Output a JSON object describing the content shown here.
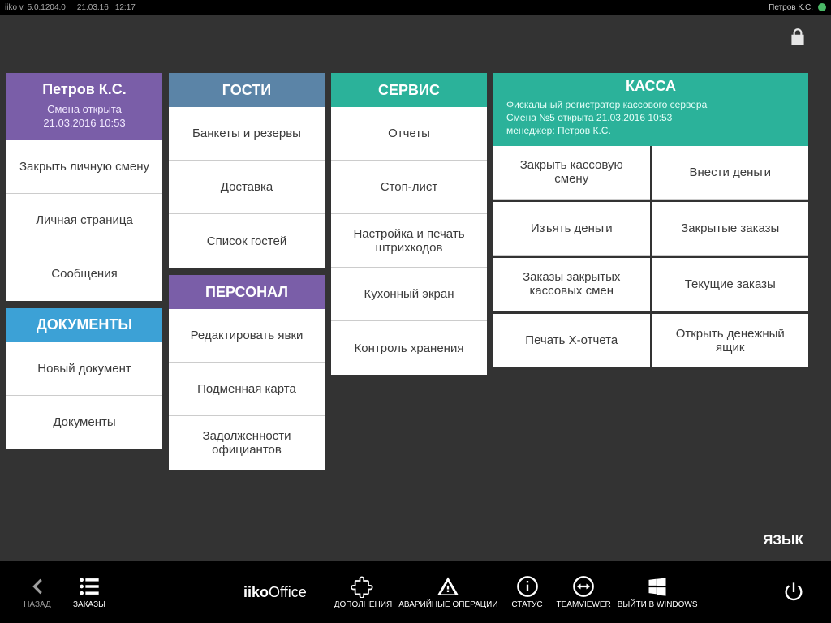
{
  "topbar": {
    "version": "iiko  v.  5.0.1204.0",
    "date": "21.03.16",
    "time": "12:17",
    "user": "Петров К.С."
  },
  "user_panel": {
    "name": "Петров К.С.",
    "shift_line1": "Смена открыта",
    "shift_line2": "21.03.2016 10:53",
    "items": [
      "Закрыть личную смену",
      "Личная страница",
      "Сообщения"
    ]
  },
  "documents": {
    "title": "ДОКУМЕНТЫ",
    "items": [
      "Новый документ",
      "Документы"
    ]
  },
  "guests": {
    "title": "ГОСТИ",
    "items": [
      "Банкеты и резервы",
      "Доставка",
      "Список гостей"
    ]
  },
  "personnel": {
    "title": "ПЕРСОНАЛ",
    "items": [
      "Редактировать явки",
      "Подменная карта",
      "Задолженности официантов"
    ]
  },
  "service": {
    "title": "СЕРВИС",
    "items": [
      "Отчеты",
      "Стоп-лист",
      "Настройка и печать штрихкодов",
      "Кухонный экран",
      "Контроль хранения"
    ]
  },
  "kassa": {
    "title": "КАССА",
    "sub1": "Фискальный регистратор кассового сервера",
    "sub2": "Смена №5 открыта 21.03.2016 10:53",
    "sub3": "менеджер: Петров К.С.",
    "items": [
      "Закрыть кассовую смену",
      "Внести деньги",
      "Изъять деньги",
      "Закрытые заказы",
      "Заказы закрытых кассовых смен",
      "Текущие заказы",
      "Печать X-отчета",
      "Открыть денежный ящик"
    ]
  },
  "language": "ЯЗЫК",
  "bottom": {
    "back": "НАЗАД",
    "orders": "ЗАКАЗЫ",
    "brand_bold": "iiko",
    "brand_light": "Office",
    "addons": "ДОПОЛНЕНИЯ",
    "emergency": "АВАРИЙНЫЕ ОПЕРАЦИИ",
    "status": "СТАТУС",
    "teamviewer": "TEAMVIEWER",
    "exit": "ВЫЙТИ В WINDOWS"
  }
}
